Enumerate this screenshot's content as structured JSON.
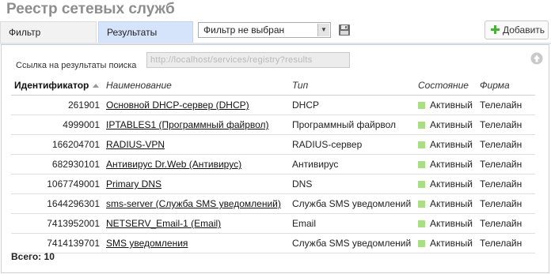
{
  "page": {
    "title": "Реестр сетевых служб"
  },
  "tabs": [
    {
      "label": "Фильтр",
      "active": false
    },
    {
      "label": "Результаты",
      "active": true
    }
  ],
  "toolbar": {
    "filter_value": "Фильтр не выбран",
    "save_icon": "floppy-disk-icon",
    "add_label": "Добавить",
    "add_icon": "plus-icon"
  },
  "search_link": {
    "label": "Ссылка на результаты поиска",
    "value": "http://localhost/services/registry?results"
  },
  "table": {
    "columns": [
      "Идентификатор",
      "Наименование",
      "Тип",
      "Состояние",
      "Фирма"
    ],
    "sorted_column": "Идентификатор",
    "rows": [
      {
        "id": "261901",
        "name": "Основной DHCP-сервер (DHCP)",
        "type": "DHCP",
        "state": "Активный",
        "firm": "Телелайн"
      },
      {
        "id": "4999001",
        "name": "IPTABLES1 (Программный файрвол)",
        "type": "Программный файрвол",
        "state": "Активный",
        "firm": "Телелайн"
      },
      {
        "id": "166204701",
        "name": "RADIUS-VPN",
        "type": "RADIUS-сервер",
        "state": "Активный",
        "firm": "Телелайн"
      },
      {
        "id": "682930101",
        "name": "Антивирус Dr.Web (Антивирус)",
        "type": "Антивирус",
        "state": "Активный",
        "firm": "Телелайн"
      },
      {
        "id": "1067749001",
        "name": "Primary DNS",
        "type": "DNS",
        "state": "Активный",
        "firm": "Телелайн"
      },
      {
        "id": "1644296301",
        "name": "sms-server (Служба SMS уведомлений)",
        "type": "Служба SMS уведомлений",
        "state": "Активный",
        "firm": "Телелайн"
      },
      {
        "id": "7413952001",
        "name": "NETSERV_Email-1 (Email)",
        "type": "Email",
        "state": "Активный",
        "firm": "Телелайн"
      },
      {
        "id": "7414139701",
        "name": "SMS уведомления",
        "type": "Служба SMS уведомлений",
        "state": "Активный",
        "firm": "Телелайн"
      }
    ],
    "status_color": "#a9de84"
  },
  "footer": {
    "total_label": "Всего:",
    "total_value": "10"
  }
}
